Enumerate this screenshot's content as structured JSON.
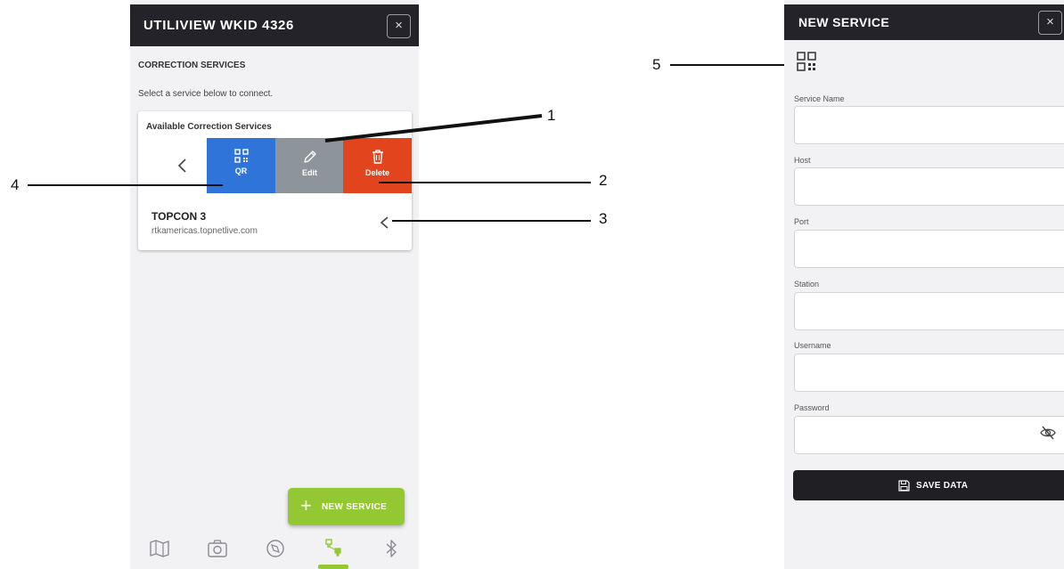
{
  "left_screen": {
    "header_title": "UTILIVIEW WKID 4326",
    "close_glyph": "×",
    "section_title": "CORRECTION SERVICES",
    "subtitle": "Select a service below to connect.",
    "card_title": "Available Correction Services",
    "actions": {
      "qr": "QR",
      "edit": "Edit",
      "delete": "Delete"
    },
    "service": {
      "name": "TOPCON 3",
      "host": "rtkamericas.topnetlive.com"
    },
    "fab": {
      "plus": "+",
      "label": "NEW SERVICE"
    },
    "nav_icons": [
      "map-icon",
      "camera-icon",
      "compass-icon",
      "rtk-icon",
      "bluetooth-icon"
    ],
    "colors": {
      "header": "#232329",
      "qr": "#2f74d8",
      "edit": "#8d949a",
      "delete": "#e2451e",
      "accent": "#94c832"
    }
  },
  "callouts": [
    "1",
    "2",
    "3",
    "4",
    "5"
  ],
  "right_screen": {
    "header_title": "NEW SERVICE",
    "close_glyph": "×",
    "fields": [
      {
        "label": "Service Name",
        "value": ""
      },
      {
        "label": "Host",
        "value": ""
      },
      {
        "label": "Port",
        "value": ""
      },
      {
        "label": "Station",
        "value": ""
      },
      {
        "label": "Username",
        "value": ""
      },
      {
        "label": "Password",
        "value": ""
      }
    ],
    "save_label": "SAVE DATA"
  }
}
